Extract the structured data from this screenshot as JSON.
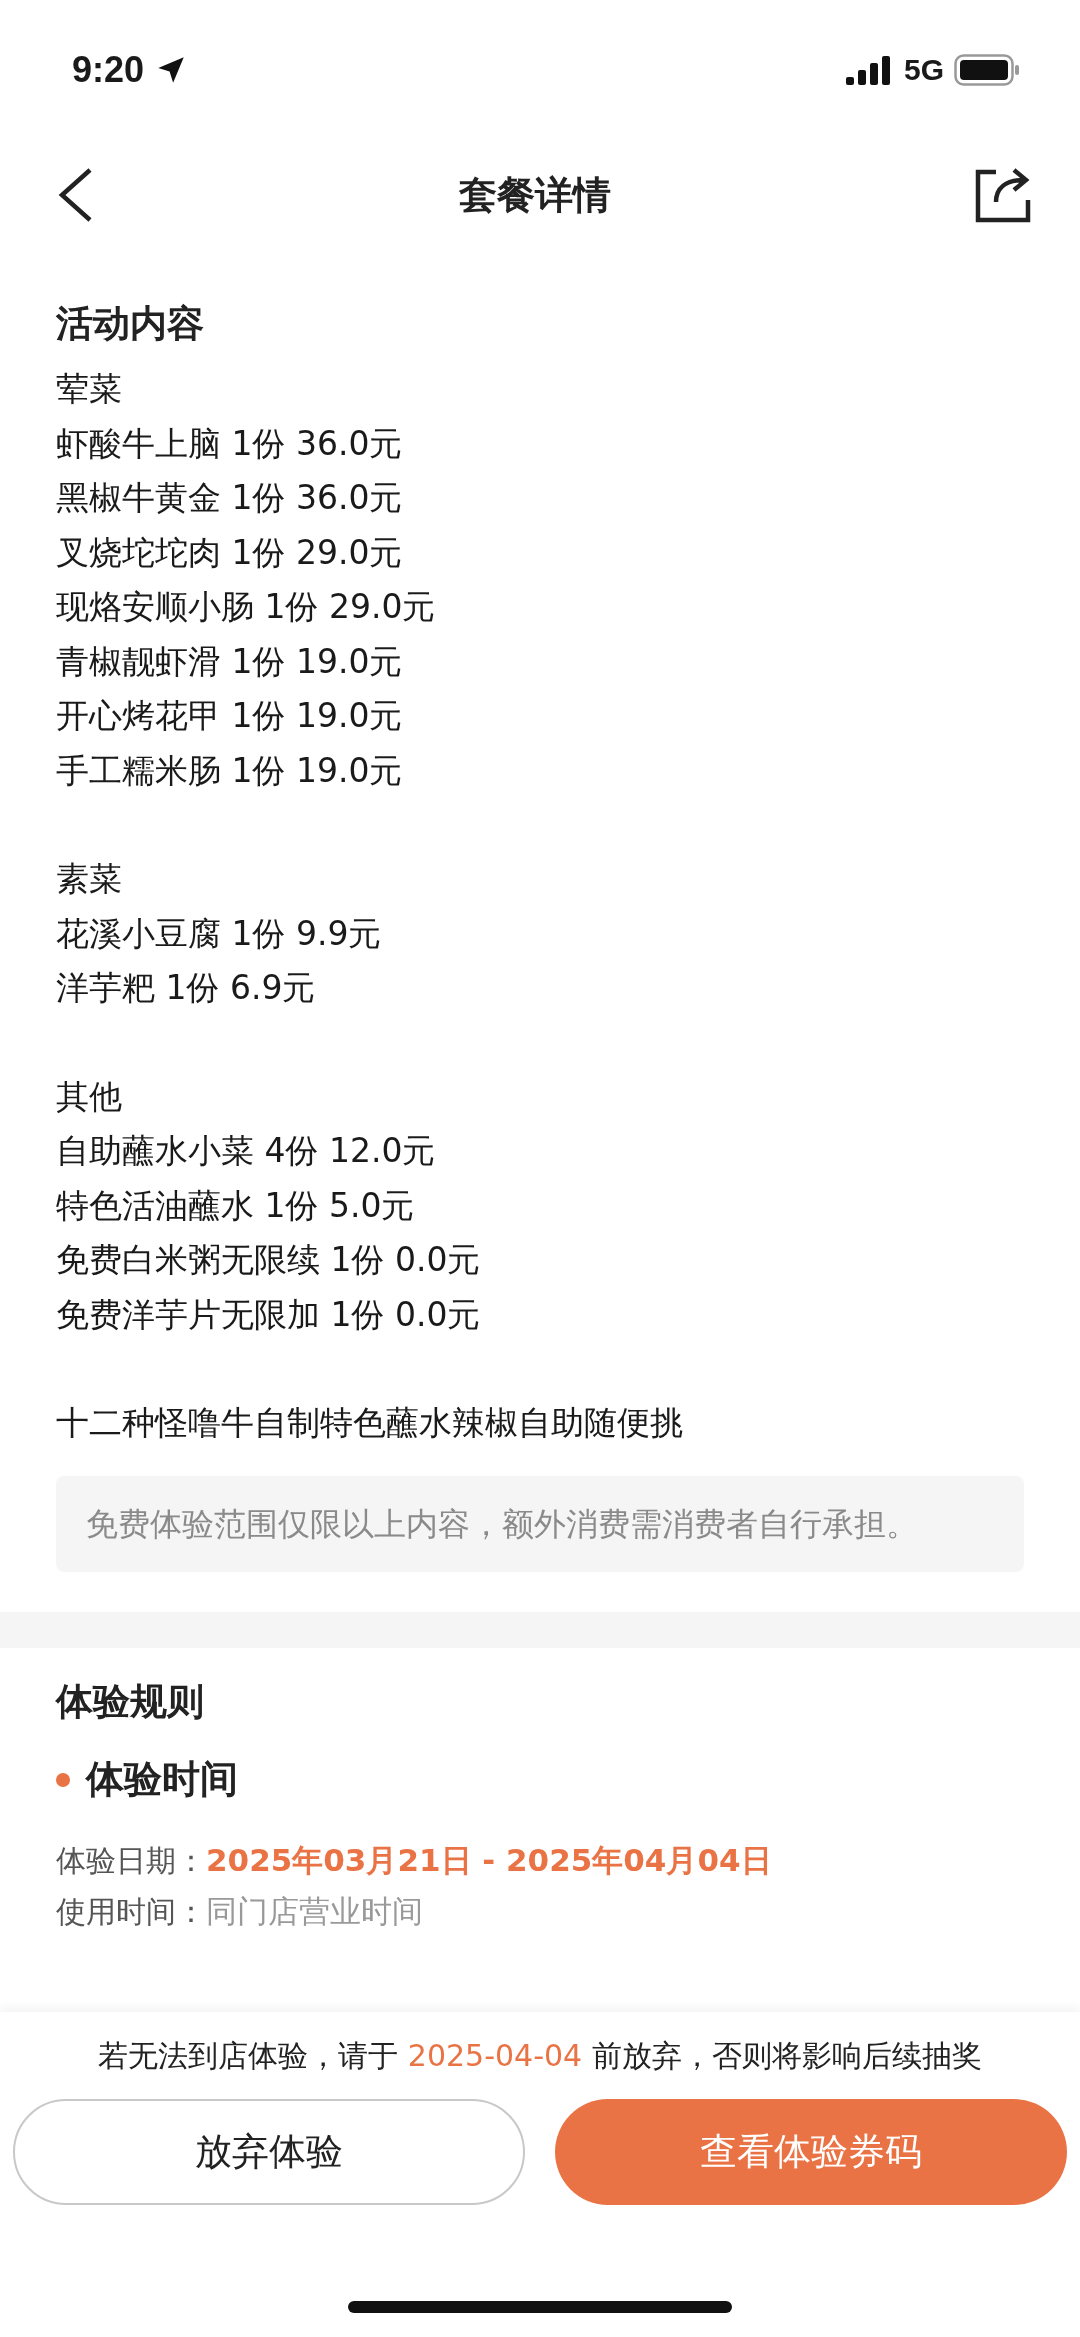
{
  "status_bar": {
    "time": "9:20",
    "network": "5G"
  },
  "nav": {
    "title": "套餐详情"
  },
  "activity": {
    "title": "活动内容",
    "groups": [
      {
        "name": "荤菜",
        "items": [
          "虾酸牛上脑 1份 36.0元",
          "黑椒牛黄金 1份 36.0元",
          "叉烧坨坨肉 1份 29.0元",
          "现烙安顺小肠 1份 29.0元",
          "青椒靓虾滑 1份 19.0元",
          "开心烤花甲 1份 19.0元",
          "手工糯米肠 1份 19.0元"
        ]
      },
      {
        "name": "素菜",
        "items": [
          "花溪小豆腐 1份 9.9元",
          "洋芋粑 1份 6.9元"
        ]
      },
      {
        "name": "其他",
        "items": [
          "自助蘸水小菜 4份 12.0元",
          "特色活油蘸水 1份 5.0元",
          "免费白米粥无限续 1份 0.0元",
          "免费洋芋片无限加 1份 0.0元"
        ]
      }
    ],
    "note": "十二种怪噜牛自制特色蘸水辣椒自助随便挑",
    "notice": "免费体验范围仅限以上内容，额外消费需消费者自行承担。"
  },
  "rules": {
    "title": "体验规则",
    "subtitle": "体验时间",
    "fields": [
      {
        "label": "体验日期：",
        "value": "2025年03月21日 - 2025年04月04日",
        "kind": "highlight"
      },
      {
        "label": "使用时间：",
        "value": "同门店营业时间",
        "kind": "plain"
      }
    ]
  },
  "footer": {
    "notice_before": "若无法到店体验，请于 ",
    "notice_date": "2025-04-04",
    "notice_after": " 前放弃，否则将影响后续抽奖",
    "buttons": [
      {
        "label": "放弃体验",
        "kind": "secondary"
      },
      {
        "label": "查看体验券码",
        "kind": "primary"
      }
    ]
  }
}
